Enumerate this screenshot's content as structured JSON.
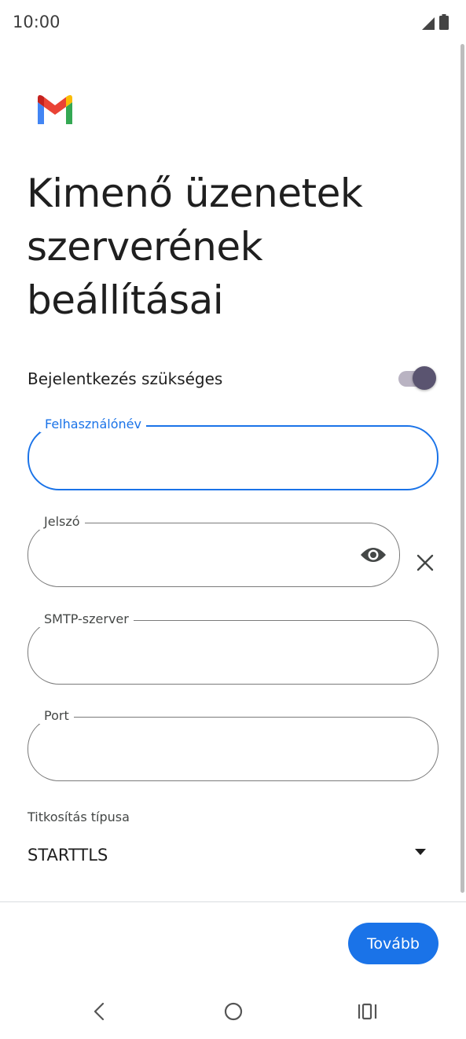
{
  "status_bar": {
    "time": "10:00",
    "icons": [
      "signal-icon",
      "battery-icon"
    ]
  },
  "app": {
    "logo": "gmail-logo",
    "brand_colors": [
      "#ea4335",
      "#4285f4",
      "#34a853",
      "#fbbc04",
      "#c5221f"
    ]
  },
  "page": {
    "title": "Kimenő üzenetek\nszerverének\nbeállításai"
  },
  "login_required": {
    "label": "Bejelentkezés szükséges",
    "enabled": true
  },
  "fields": {
    "username": {
      "label": "Felhasználónév",
      "value": "",
      "focused": true
    },
    "password": {
      "label": "Jelszó",
      "value": "",
      "icons": [
        "eye-icon",
        "close-icon"
      ]
    },
    "smtp_server": {
      "label": "SMTP-szerver",
      "value": ""
    },
    "port": {
      "label": "Port",
      "value": ""
    }
  },
  "encryption": {
    "label": "Titkosítás típusa",
    "selected": "STARTTLS"
  },
  "actions": {
    "next_label": "Tovább"
  },
  "navigation": {
    "buttons": [
      "back-icon",
      "home-icon",
      "recents-icon"
    ]
  },
  "colors": {
    "accent": "#1a73e8",
    "toggle_thumb": "#5a5470",
    "toggle_track": "#b9b3c2"
  }
}
